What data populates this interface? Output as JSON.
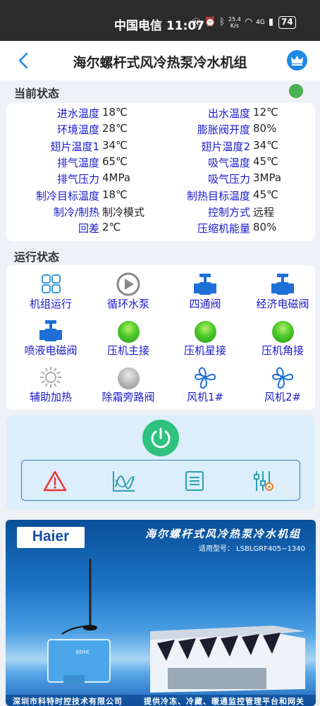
{
  "status_bar": {
    "carrier_time": "中国电信 11:07",
    "net_speed_value": "25.4",
    "net_speed_unit": "K/s",
    "signal": "4G",
    "battery": "74"
  },
  "header": {
    "title": "海尔螺杆式风冷热泵冷水机组"
  },
  "current_status": {
    "title": "当前状态",
    "indicator_color": "#4caf50",
    "rows": [
      {
        "l1": "进水温度",
        "v1": "18℃",
        "l2": "出水温度",
        "v2": "12℃"
      },
      {
        "l1": "环境温度",
        "v1": "28℃",
        "l2": "膨胀阀开度",
        "v2": "80%"
      },
      {
        "l1": "翅片温度1",
        "v1": "34℃",
        "l2": "翅片温度2",
        "v2": "34℃"
      },
      {
        "l1": "排气温度",
        "v1": "65℃",
        "l2": "吸气温度",
        "v2": "45℃"
      },
      {
        "l1": "排气压力",
        "v1": "4MPa",
        "l2": "吸气压力",
        "v2": "3MPa"
      },
      {
        "l1": "制冷目标温度",
        "v1": "18℃",
        "l2": "制热目标温度",
        "v2": "45℃"
      },
      {
        "l1": "制冷/制热",
        "v1": "制冷模式",
        "l2": "控制方式",
        "v2": "远程"
      },
      {
        "l1": "回差",
        "v1": "2℃",
        "l2": "压缩机能量",
        "v2": "80%"
      }
    ]
  },
  "run_status": {
    "title": "运行状态",
    "items": [
      {
        "label": "机组运行",
        "icon": "grid-icon"
      },
      {
        "label": "循环水泵",
        "icon": "play-circle-icon"
      },
      {
        "label": "四通阀",
        "icon": "valve-icon"
      },
      {
        "label": "经济电磁阀",
        "icon": "valve-icon"
      },
      {
        "label": "喷液电磁阀",
        "icon": "valve-icon"
      },
      {
        "label": "压机主接",
        "icon": "green-ball-icon"
      },
      {
        "label": "压机星接",
        "icon": "green-ball-icon"
      },
      {
        "label": "压机角接",
        "icon": "green-ball-icon"
      },
      {
        "label": "辅助加热",
        "icon": "sun-icon"
      },
      {
        "label": "除霜旁路阀",
        "icon": "gray-ball-icon"
      },
      {
        "label": "风机1#",
        "icon": "fan-icon"
      },
      {
        "label": "风机2#",
        "icon": "fan-icon"
      }
    ]
  },
  "controls": {
    "power": "power-icon",
    "tools": [
      "alarm-icon",
      "chart-icon",
      "list-icon",
      "settings-sliders-icon"
    ]
  },
  "banner": {
    "brand": "Haier",
    "title": "海尔螺杆式风冷热泵冷水机组",
    "model": "适用型号： LSBLGRF405~1340",
    "footer_left": "深圳市科特时控技术有限公司",
    "footer_right": "提供冷冻、冷藏、暖通监控管理平台和网关"
  }
}
